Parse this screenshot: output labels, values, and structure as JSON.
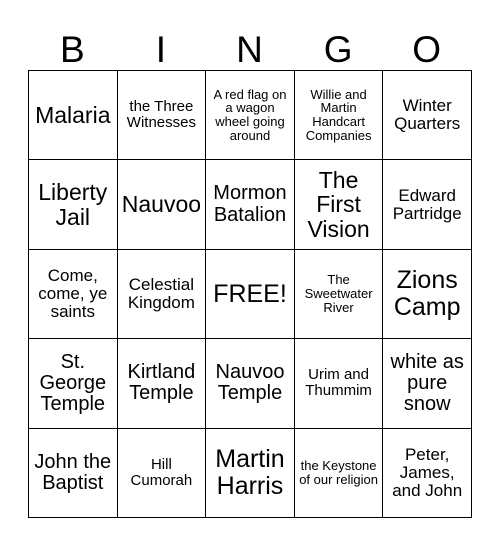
{
  "card": {
    "header_letters": [
      "B",
      "I",
      "N",
      "G",
      "O"
    ],
    "rows": [
      [
        {
          "text": "Malaria",
          "size": "lg"
        },
        {
          "text": "the Three Witnesses",
          "size": "xs"
        },
        {
          "text": "A red flag on a wagon wheel going around",
          "size": "xxs"
        },
        {
          "text": "Willie and Martin Handcart Companies",
          "size": "xxs"
        },
        {
          "text": "Winter Quarters",
          "size": "sm"
        }
      ],
      [
        {
          "text": "Liberty Jail",
          "size": "lg"
        },
        {
          "text": "Nauvoo",
          "size": "lg"
        },
        {
          "text": "Mormon Batalion",
          "size": "md"
        },
        {
          "text": "The First Vision",
          "size": "lg"
        },
        {
          "text": "Edward Partridge",
          "size": "sm"
        }
      ],
      [
        {
          "text": "Come, come, ye saints",
          "size": "sm"
        },
        {
          "text": "Celestial Kingdom",
          "size": "sm"
        },
        {
          "text": "FREE!",
          "size": "xl"
        },
        {
          "text": "The Sweetwater River",
          "size": "xxs"
        },
        {
          "text": "Zions Camp",
          "size": "xl"
        }
      ],
      [
        {
          "text": "St. George Temple",
          "size": "md"
        },
        {
          "text": "Kirtland Temple",
          "size": "md"
        },
        {
          "text": "Nauvoo Temple",
          "size": "md"
        },
        {
          "text": "Urim and Thummim",
          "size": "xs"
        },
        {
          "text": "white as pure snow",
          "size": "md"
        }
      ],
      [
        {
          "text": "John the Baptist",
          "size": "md"
        },
        {
          "text": "Hill Cumorah",
          "size": "xs"
        },
        {
          "text": "Martin Harris",
          "size": "xl"
        },
        {
          "text": "the Keystone of our religion",
          "size": "xxs"
        },
        {
          "text": "Peter, James, and John",
          "size": "sm"
        }
      ]
    ]
  }
}
